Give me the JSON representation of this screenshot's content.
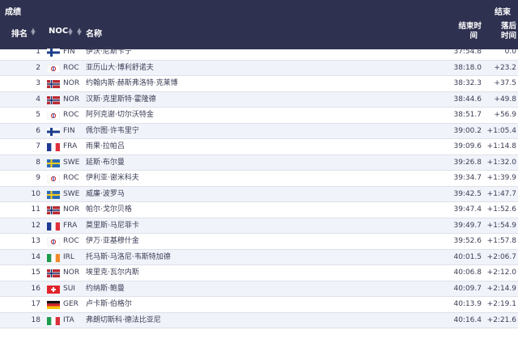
{
  "header": {
    "title": "成绩",
    "status": "结束"
  },
  "columns": {
    "rank": "排名",
    "noc": "NOC",
    "name": "名称",
    "time_l1": "结束时",
    "time_l2": "间",
    "gap_l1": "落后",
    "gap_l2": "时间"
  },
  "rows": [
    {
      "rank": "1",
      "noc": "FIN",
      "name": "伊沃·尼斯卡宁",
      "time": "37:54.8",
      "gap": "0.0",
      "flag": "fin"
    },
    {
      "rank": "2",
      "noc": "ROC",
      "name": "亚历山大·博利舒诺夫",
      "time": "38:18.0",
      "gap": "+23.2",
      "flag": "roc"
    },
    {
      "rank": "3",
      "noc": "NOR",
      "name": "约翰内斯·赫斯弗洛特·克莱博",
      "time": "38:32.3",
      "gap": "+37.5",
      "flag": "nor"
    },
    {
      "rank": "4",
      "noc": "NOR",
      "name": "汉斯·克里斯特·霍隆德",
      "time": "38:44.6",
      "gap": "+49.8",
      "flag": "nor"
    },
    {
      "rank": "5",
      "noc": "ROC",
      "name": "阿列克谢·切尔沃特金",
      "time": "38:51.7",
      "gap": "+56.9",
      "flag": "roc"
    },
    {
      "rank": "6",
      "noc": "FIN",
      "name": "佩尔图·许韦里宁",
      "time": "39:00.2",
      "gap": "+1:05.4",
      "flag": "fin"
    },
    {
      "rank": "7",
      "noc": "FRA",
      "name": "雨果·拉帕吕",
      "time": "39:09.6",
      "gap": "+1:14.8",
      "flag": "fra"
    },
    {
      "rank": "8",
      "noc": "SWE",
      "name": "延斯·布尔曼",
      "time": "39:26.8",
      "gap": "+1:32.0",
      "flag": "swe"
    },
    {
      "rank": "9",
      "noc": "ROC",
      "name": "伊利亚·谢米科夫",
      "time": "39:34.7",
      "gap": "+1:39.9",
      "flag": "roc"
    },
    {
      "rank": "10",
      "noc": "SWE",
      "name": "威廉·波罗马",
      "time": "39:42.5",
      "gap": "+1:47.7",
      "flag": "swe"
    },
    {
      "rank": "11",
      "noc": "NOR",
      "name": "帕尔·戈尔贝格",
      "time": "39:47.4",
      "gap": "+1:52.6",
      "flag": "nor"
    },
    {
      "rank": "12",
      "noc": "FRA",
      "name": "莫里斯·马尼菲卡",
      "time": "39:49.7",
      "gap": "+1:54.9",
      "flag": "fra"
    },
    {
      "rank": "13",
      "noc": "ROC",
      "name": "伊万·亚基穆什金",
      "time": "39:52.6",
      "gap": "+1:57.8",
      "flag": "roc"
    },
    {
      "rank": "14",
      "noc": "IRL",
      "name": "托马斯·马洛尼·韦斯特加德",
      "time": "40:01.5",
      "gap": "+2:06.7",
      "flag": "irl"
    },
    {
      "rank": "15",
      "noc": "NOR",
      "name": "埃里克·瓦尔内斯",
      "time": "40:06.8",
      "gap": "+2:12.0",
      "flag": "nor"
    },
    {
      "rank": "16",
      "noc": "SUI",
      "name": "约纳斯·鲍曼",
      "time": "40:09.7",
      "gap": "+2:14.9",
      "flag": "sui"
    },
    {
      "rank": "17",
      "noc": "GER",
      "name": "卢卡斯·伯格尔",
      "time": "40:13.9",
      "gap": "+2:19.1",
      "flag": "ger"
    },
    {
      "rank": "18",
      "noc": "ITA",
      "name": "弗朗切斯科·德法比亚尼",
      "time": "40:16.4",
      "gap": "+2:21.6",
      "flag": "ita"
    }
  ],
  "colors": {
    "header_bg": "#2f3150",
    "row_alt": "#f1f3fa",
    "divider": "#dfe1ea",
    "text": "#3a3d55"
  }
}
